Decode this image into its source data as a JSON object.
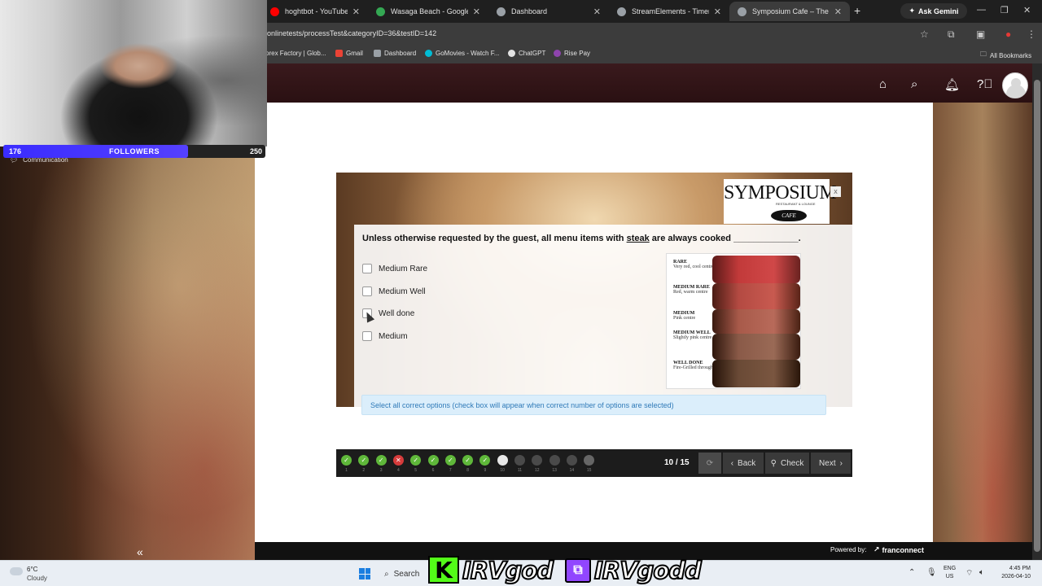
{
  "browser": {
    "tabs": [
      {
        "title": "hoghtbot - YouTube",
        "icon_color": "#ff0000"
      },
      {
        "title": "Wasaga Beach - Google Ma",
        "icon_color": "#34a853"
      },
      {
        "title": "Dashboard",
        "icon_color": "#9aa0a6"
      },
      {
        "title": "StreamElements - Timers",
        "icon_color": "#9aa0a6"
      },
      {
        "title": "Symposium Cafe – The Scro",
        "icon_color": "#9aa0a6"
      }
    ],
    "gemini_label": "Ask Gemini",
    "url": "onlinetests/processTest&categoryID=36&testID=142",
    "bookmarks": [
      {
        "label": "orex Factory | Glob...",
        "color": "#3c3c3c"
      },
      {
        "label": "Gmail",
        "color": "#ea4335"
      },
      {
        "label": "Dashboard",
        "color": "#9aa0a6"
      },
      {
        "label": "GoMovies - Watch F...",
        "color": "#00bcd4"
      },
      {
        "label": "ChatGPT",
        "color": "#e3e3e3"
      },
      {
        "label": "Rise Pay",
        "color": "#8e44ad"
      }
    ],
    "all_bookmarks": "All Bookmarks"
  },
  "header": {
    "icons": [
      "home-icon",
      "search-icon",
      "bell-icon",
      "help-icon"
    ],
    "background": "#2a1012"
  },
  "sidebar": {
    "item": "Communication"
  },
  "overlay": {
    "followers_current": "176",
    "followers_label": "FOLLOWERS",
    "followers_goal": "250",
    "followers_progress": 0.704
  },
  "quiz": {
    "logo_text": "SYMPOSIUM",
    "logo_sub": "RESTAURANT & LOUNGE",
    "logo_cafe": "CAFE",
    "close": "x",
    "question_before": "Unless otherwise requested by the guest, all menu items with ",
    "question_keyword": "steak",
    "question_after": " are always cooked _____________.",
    "options": [
      "Medium Rare",
      "Medium Well",
      "Well done",
      "Medium"
    ],
    "steak_guide": [
      {
        "title": "RARE",
        "desc": "Very red, cool centre"
      },
      {
        "title": "MEDIUM RARE",
        "desc": "Red, warm centre"
      },
      {
        "title": "MEDIUM",
        "desc": "Pink centre"
      },
      {
        "title": "MEDIUM WELL",
        "desc": "Slightly pink centre"
      },
      {
        "title": "WELL DONE",
        "desc": "Fire-Grilled throughout"
      }
    ],
    "hint": "Select all correct options (check box will appear when correct number of options are selected)"
  },
  "navigation": {
    "progress": [
      {
        "num": "1",
        "status": "correct"
      },
      {
        "num": "2",
        "status": "correct"
      },
      {
        "num": "3",
        "status": "correct"
      },
      {
        "num": "4",
        "status": "wrong"
      },
      {
        "num": "5",
        "status": "correct"
      },
      {
        "num": "6",
        "status": "correct"
      },
      {
        "num": "7",
        "status": "correct"
      },
      {
        "num": "8",
        "status": "correct"
      },
      {
        "num": "9",
        "status": "correct"
      },
      {
        "num": "10",
        "status": "current"
      },
      {
        "num": "11",
        "status": "pending"
      },
      {
        "num": "12",
        "status": "pending"
      },
      {
        "num": "13",
        "status": "pending"
      },
      {
        "num": "14",
        "status": "pending"
      },
      {
        "num": "15",
        "status": "last"
      }
    ],
    "counter": "10 / 15",
    "back": "Back",
    "check": "Check",
    "next": "Next"
  },
  "footer": {
    "powered_label": "Powered by:",
    "powered_brand": "franconnect"
  },
  "taskbar": {
    "temp": "6°C",
    "weather": "Cloudy",
    "search": "Search",
    "brand_left": "IRVgod",
    "brand_right": "IRVgodd",
    "lang_1": "ENG",
    "lang_2": "US",
    "time": "4:45 PM",
    "date": "2026-04-10"
  }
}
